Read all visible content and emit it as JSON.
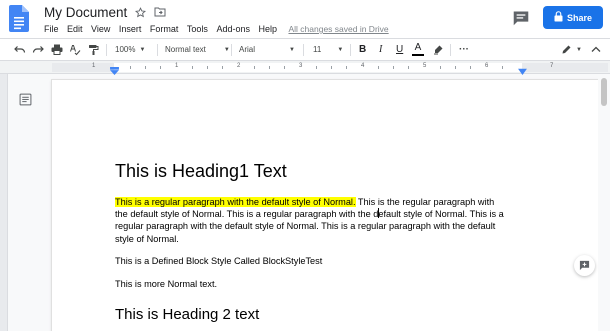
{
  "doc": {
    "title": "My Document",
    "saved_status": "All changes saved in Drive"
  },
  "menu": [
    "File",
    "Edit",
    "View",
    "Insert",
    "Format",
    "Tools",
    "Add-ons",
    "Help"
  ],
  "share": {
    "label": "Share"
  },
  "toolbar": {
    "zoom": "100%",
    "style": "Normal text",
    "font": "Arial",
    "font_size": "11",
    "bold": "B",
    "italic": "I",
    "underline": "U",
    "text_color": "A",
    "more": "···"
  },
  "ruler": {
    "numbers": [
      "1",
      "1",
      "2",
      "3",
      "4",
      "5",
      "6",
      "7"
    ]
  },
  "content": {
    "heading1": "This is Heading1 Text",
    "para1_highlighted": "This is a regular paragraph with the default style of Normal.",
    "para1_line1_rest": " This is the regular paragraph with",
    "para1_line2_a": "the default style of Normal. This is a regular paragraph with the d",
    "para1_line2_b": "efault style of Normal. This is a",
    "para1_line3": "regular paragraph with the default style of Normal. This is a regular paragraph with the default",
    "para1_line4": "style of Normal.",
    "para2": "This is a Defined Block Style Called BlockStyleTest",
    "para3": "This is more Normal text.",
    "heading2": "This is Heading 2 text"
  },
  "colors": {
    "brand_blue": "#1a73e8",
    "docs_blue": "#4285f4",
    "highlight": "#ffff00",
    "ruler_marker": "#4285f4"
  },
  "icons": {
    "logo": "docs-logo-icon",
    "star": "star-icon",
    "move": "folder-move-icon",
    "comments": "comments-icon",
    "lock": "lock-icon",
    "undo": "undo-icon",
    "redo": "redo-icon",
    "print": "print-icon",
    "spellcheck": "spellcheck-icon",
    "paint_format": "paint-format-icon",
    "highlight": "highlighter-icon",
    "edit_mode": "pencil-icon",
    "collapse": "chevron-up-icon",
    "outline": "document-outline-icon",
    "add_comment": "add-comment-icon"
  }
}
